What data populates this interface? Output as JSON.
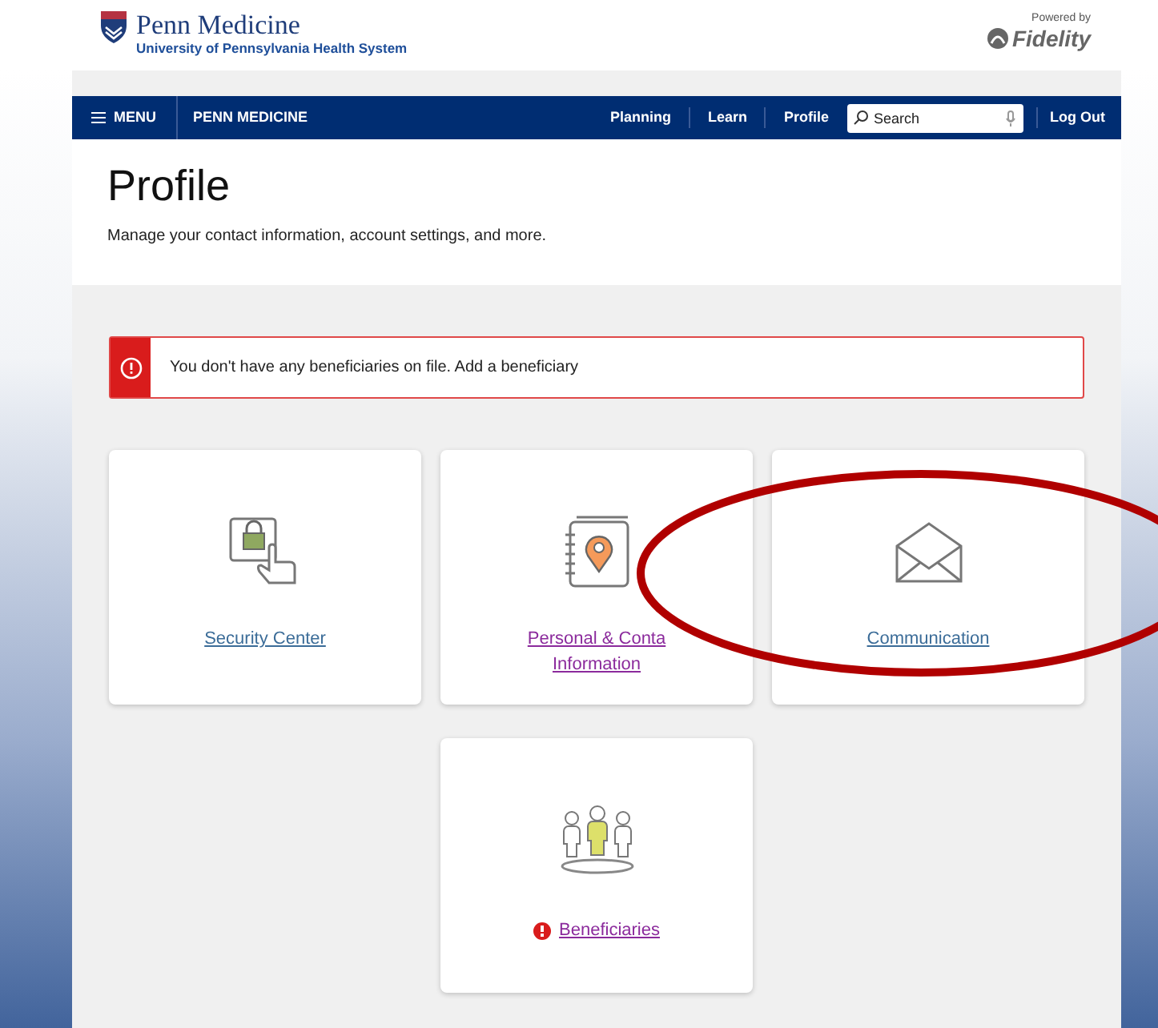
{
  "brand": {
    "name": "Penn Medicine",
    "subtitle": "University of Pennsylvania Health System",
    "powered_by": "Powered by",
    "partner": "Fidelity"
  },
  "nav": {
    "menu": "MENU",
    "site": "PENN MEDICINE",
    "links": [
      "Planning",
      "Learn",
      "Profile"
    ],
    "search": {
      "placeholder": "Search"
    },
    "logout": "Log Out"
  },
  "page": {
    "title": "Profile",
    "subtitle": "Manage your contact information, account settings, and more."
  },
  "alert": {
    "text": "You don't have any beneficiaries on file. Add a beneficiary"
  },
  "cards": [
    {
      "kind": "security",
      "label": "Security Center",
      "visited": false,
      "warning": false
    },
    {
      "kind": "contact",
      "label": "Personal & Conta",
      "label_2": "Information",
      "visited": true,
      "warning": false
    },
    {
      "kind": "communication",
      "label": "Communication",
      "visited": false,
      "warning": false
    },
    {
      "kind": "beneficiaries",
      "label": "Beneficiaries",
      "visited": true,
      "warning": true
    }
  ],
  "annotation": {
    "kind": "ellipse",
    "color": "#b00000"
  }
}
